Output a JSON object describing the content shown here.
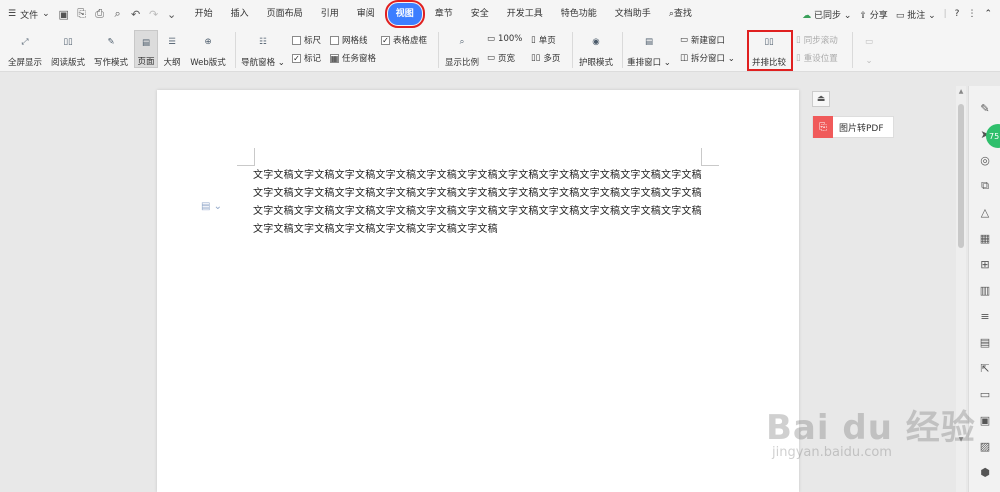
{
  "menubar": {
    "file_label": "文件",
    "tabs": [
      "开始",
      "插入",
      "页面布局",
      "引用",
      "审阅",
      "视图",
      "章节",
      "安全",
      "开发工具",
      "特色功能",
      "文档助手"
    ],
    "search_label": "查找",
    "sync_label": "已同步",
    "share_label": "分享",
    "comment_label": "批注"
  },
  "ribbon": {
    "fullscreen": "全屏显示",
    "reading": "阅读版式",
    "writing": "写作模式",
    "page": "页面",
    "outline": "大纲",
    "web": "Web版式",
    "nav_pane": "导航窗格",
    "ruler": "标尺",
    "gridlines": "网格线",
    "table_gridlines": "表格虚框",
    "marks": "标记",
    "task_pane": "任务窗格",
    "zoom": "显示比例",
    "zoom_100": "100%",
    "page_width": "页宽",
    "single_page": "单页",
    "multi_page": "多页",
    "eye_mode": "护眼模式",
    "rearrange": "重排窗口",
    "new_window": "新建窗口",
    "split_window": "拆分窗口",
    "side_by_side": "并排比较",
    "sync_scroll": "同步滚动",
    "reset_position": "重设位置"
  },
  "document": {
    "body_text": "文字文稿文字文稿文字文稿文字文稿文字文稿文字文稿文字文稿文字文稿文字文稿文字文稿文字文稿文字文稿文字文稿文字文稿文字文稿文字文稿文字文稿文字文稿文字文稿文字文稿文字文稿文字文稿文字文稿文字文稿文字文稿文字文稿文字文稿文字文稿文字文稿文字文稿文字文稿文字文稿文字文稿文字文稿文字文稿文字文稿文字文稿文字文稿文字文稿"
  },
  "floating": {
    "pdf_label": "图片转PDF",
    "badge_text": "75"
  },
  "watermark": {
    "main": "Bai du 经验",
    "sub": "jingyan.baidu.com"
  },
  "colors": {
    "accent": "#3d7eff",
    "highlight": "#e02020",
    "pdf": "#f05a5a",
    "badge": "#2fbf6c"
  }
}
